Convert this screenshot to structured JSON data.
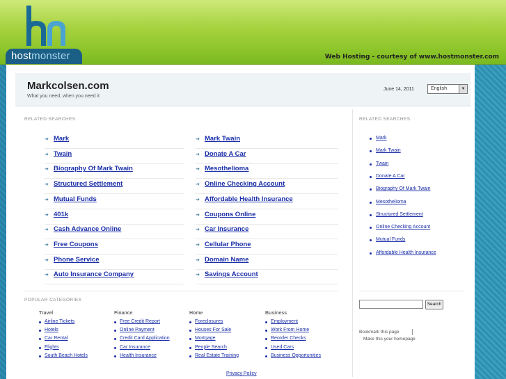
{
  "brand": {
    "logo_host": "host",
    "logo_monster": "monster",
    "courtesy": "Web Hosting - courtesy of www.hostmonster.com"
  },
  "header": {
    "site_title": "Markcolsen.com",
    "site_subtitle": "What you need, when you need it",
    "date": "June 14, 2011",
    "language": "English"
  },
  "related_searches_label": "RELATED SEARCHES",
  "related_searches": [
    "Mark",
    "Mark Twain",
    "Twain",
    "Donate A Car",
    "Biography Of Mark Twain",
    "Mesothelioma",
    "Structured Settlement",
    "Online Checking Account",
    "Mutual Funds",
    "Affordable Health Insurance",
    "401k",
    "Coupons Online",
    "Cash Advance Online",
    "Car Insurance",
    "Free Coupons",
    "Cellular Phone",
    "Phone Service",
    "Domain Name",
    "Auto Insurance Company",
    "Savings Account"
  ],
  "right_related_label": "RELATED SEARCHES",
  "right_related": [
    "Mark",
    "Mark Twain",
    "Twain",
    "Donate A Car",
    "Biography Of Mark Twain",
    "Mesothelioma",
    "Structured Settlement",
    "Online Checking Account",
    "Mutual Funds",
    "Affordable Health Insurance"
  ],
  "popular_label": "POPULAR CATEGORIES",
  "popular": [
    {
      "title": "Travel",
      "items": [
        "Airline Tickets",
        "Hotels",
        "Car Rental",
        "Flights",
        "South Beach Hotels"
      ]
    },
    {
      "title": "Finance",
      "items": [
        "Free Credit Report",
        "Online Payment",
        "Credit Card Application",
        "Car Insurance",
        "Health Insurance"
      ]
    },
    {
      "title": "Home",
      "items": [
        "Foreclosures",
        "Houses For Sale",
        "Mortgage",
        "People Search",
        "Real Estate Training"
      ]
    },
    {
      "title": "Business",
      "items": [
        "Employment",
        "Work From Home",
        "Reorder Checks",
        "Used Cars",
        "Business Opportunities"
      ]
    }
  ],
  "search": {
    "button": "Search",
    "value": ""
  },
  "bookmark": {
    "bookmark": "Bookmark this page",
    "homepage": "Make this your homepage"
  },
  "footer": {
    "privacy": "Privacy Policy"
  }
}
